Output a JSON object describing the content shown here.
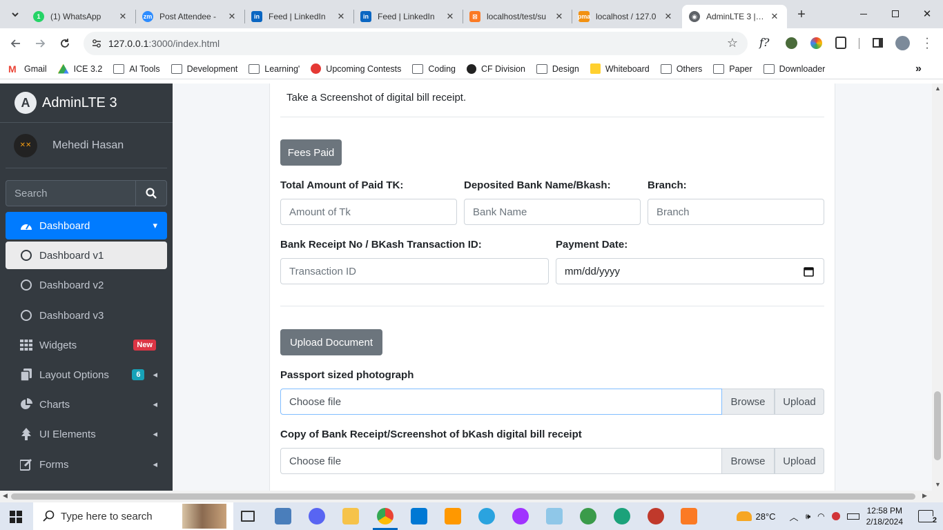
{
  "browser": {
    "tabs": [
      {
        "title": "(1) WhatsApp",
        "icon": "whatsapp-icon",
        "color": "#25d366"
      },
      {
        "title": "Post Attendee -",
        "icon": "zoom-icon",
        "color": "#2d8cff"
      },
      {
        "title": "Feed | LinkedIn",
        "icon": "linkedin-icon",
        "color": "#0a66c2"
      },
      {
        "title": "Feed | LinkedIn",
        "icon": "linkedin-icon",
        "color": "#0a66c2"
      },
      {
        "title": "localhost/test/su",
        "icon": "xampp-icon",
        "color": "#fb7a24"
      },
      {
        "title": "localhost / 127.0",
        "icon": "phpmyadmin-icon",
        "color": "#f29111"
      },
      {
        "title": "AdminLTE 3 | Da",
        "icon": "globe-icon",
        "color": "#5f6368"
      }
    ],
    "url_host": "127.0.0.1",
    "url_path": ":3000/index.html",
    "bookmarks": [
      {
        "label": "Gmail",
        "icon": "gmail-icon"
      },
      {
        "label": "ICE 3.2",
        "icon": "drive-icon"
      },
      {
        "label": "AI Tools",
        "icon": "folder-icon"
      },
      {
        "label": "Development",
        "icon": "folder-icon"
      },
      {
        "label": "Learning'",
        "icon": "folder-icon"
      },
      {
        "label": "Upcoming Contests",
        "icon": "contest-icon"
      },
      {
        "label": "Coding",
        "icon": "folder-icon"
      },
      {
        "label": "CF Division",
        "icon": "cf-icon"
      },
      {
        "label": "Design",
        "icon": "folder-icon"
      },
      {
        "label": "Whiteboard",
        "icon": "miro-icon"
      },
      {
        "label": "Others",
        "icon": "folder-icon"
      },
      {
        "label": "Paper",
        "icon": "folder-icon"
      },
      {
        "label": "Downloader",
        "icon": "folder-icon"
      }
    ]
  },
  "sidebar": {
    "brand": "AdminLTE 3",
    "user": "Mehedi Hasan",
    "search_placeholder": "Search",
    "items": [
      {
        "label": "Dashboard",
        "icon": "tachometer-icon"
      },
      {
        "label": "Dashboard v1",
        "icon": "circle-icon"
      },
      {
        "label": "Dashboard v2",
        "icon": "circle-icon"
      },
      {
        "label": "Dashboard v3",
        "icon": "circle-icon"
      },
      {
        "label": "Widgets",
        "icon": "th-icon",
        "badge": "New"
      },
      {
        "label": "Layout Options",
        "icon": "copy-icon",
        "badge": "6"
      },
      {
        "label": "Charts",
        "icon": "pie-chart-icon"
      },
      {
        "label": "UI Elements",
        "icon": "tree-icon"
      },
      {
        "label": "Forms",
        "icon": "edit-icon"
      }
    ]
  },
  "form": {
    "note": "Take a Screenshot of digital bill receipt.",
    "fees_button": "Fees Paid",
    "amount_label": "Total Amount of Paid TK:",
    "amount_placeholder": "Amount of Tk",
    "bank_label": "Deposited Bank Name/Bkash:",
    "bank_placeholder": "Bank Name",
    "branch_label": "Branch:",
    "branch_placeholder": "Branch",
    "receipt_label": "Bank Receipt No / BKash Transaction ID:",
    "receipt_placeholder": "Transaction ID",
    "date_label": "Payment Date:",
    "date_placeholder": "mm/dd/yyyy",
    "upload_button": "Upload Document",
    "photo_label": "Passport sized photograph",
    "receipt_copy_label": "Copy of Bank Receipt/Screenshot of bKash digital bill receipt",
    "choose_file": "Choose file",
    "browse": "Browse",
    "upload": "Upload"
  },
  "taskbar": {
    "search_placeholder": "Type here to search",
    "weather": "28°C",
    "time": "12:58 PM",
    "date": "2/18/2024",
    "notifications": "2"
  }
}
